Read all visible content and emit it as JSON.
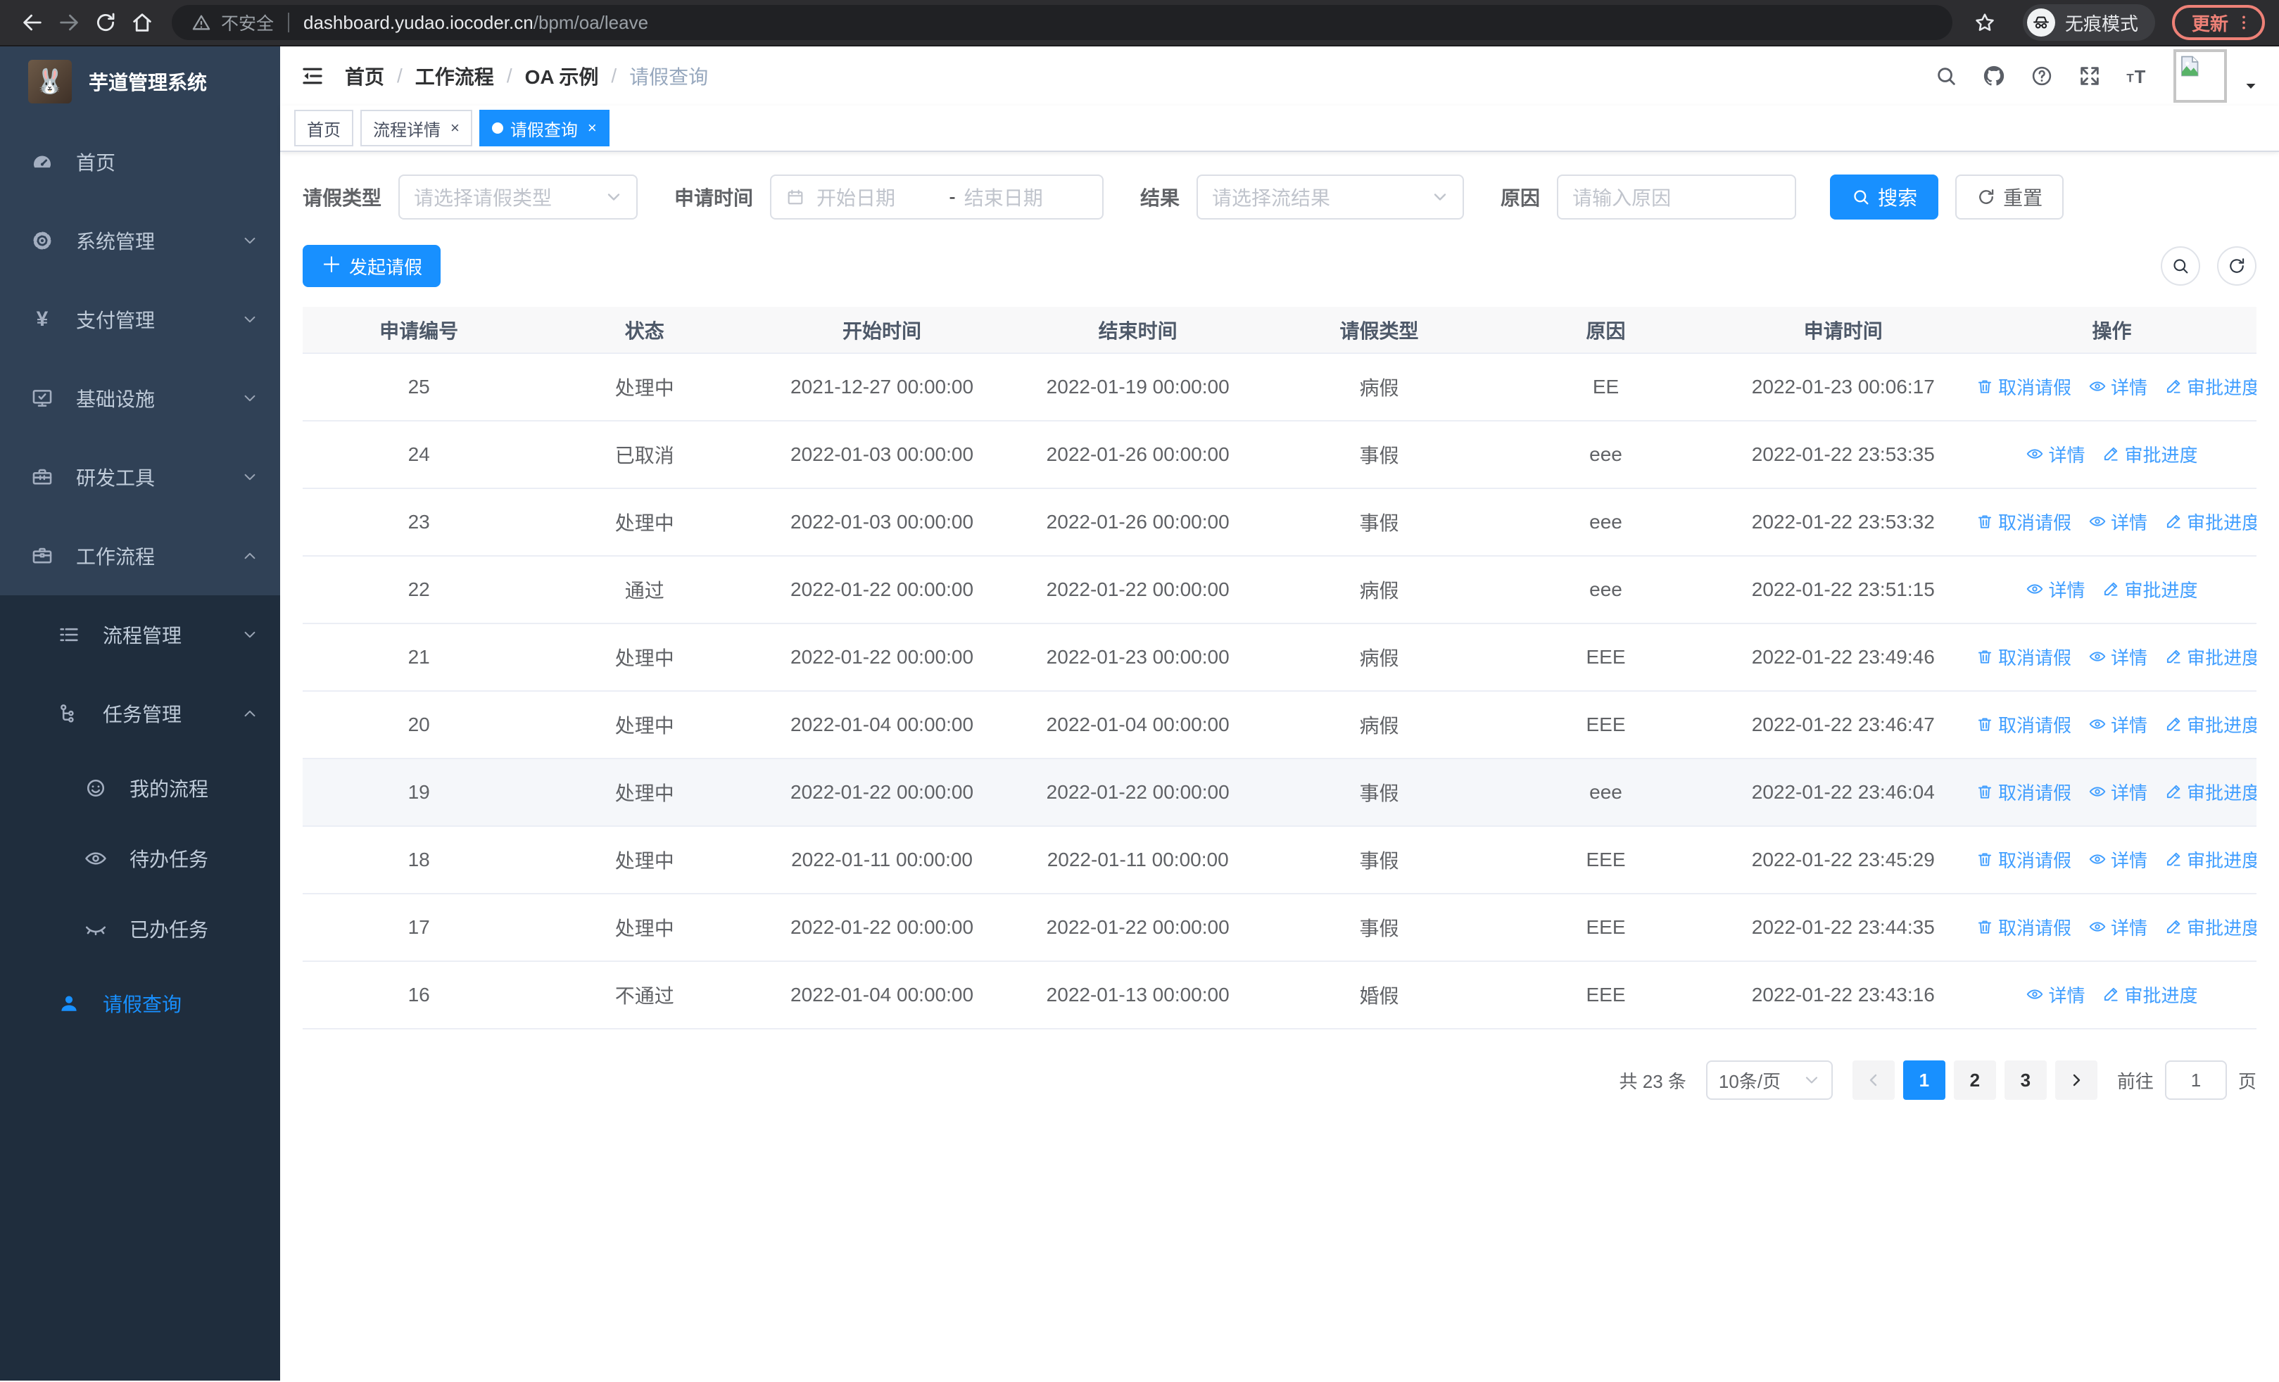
{
  "browser": {
    "security_label": "不安全",
    "url_host": "dashboard.yudao.iocoder.cn",
    "url_path": "/bpm/oa/leave",
    "incognito_label": "无痕模式",
    "update_label": "更新"
  },
  "sidebar": {
    "title": "芋道管理系统",
    "items": [
      {
        "key": "home",
        "label": "首页",
        "icon": "dashboard-icon",
        "level": 1
      },
      {
        "key": "system",
        "label": "系统管理",
        "icon": "gear-icon",
        "level": 1,
        "chevron": "down"
      },
      {
        "key": "payment",
        "label": "支付管理",
        "icon": "yen-icon",
        "level": 1,
        "chevron": "down"
      },
      {
        "key": "infrastructure",
        "label": "基础设施",
        "icon": "monitor-icon",
        "level": 1,
        "chevron": "down"
      },
      {
        "key": "dev-tools",
        "label": "研发工具",
        "icon": "toolbox-icon",
        "level": 1,
        "chevron": "down"
      },
      {
        "key": "workflow",
        "label": "工作流程",
        "icon": "briefcase-icon",
        "level": 1,
        "chevron": "up"
      },
      {
        "key": "process-mgmt",
        "label": "流程管理",
        "icon": "list-icon",
        "level": 2,
        "chevron": "down"
      },
      {
        "key": "task-mgmt",
        "label": "任务管理",
        "icon": "tree-icon",
        "level": 2,
        "chevron": "up"
      },
      {
        "key": "my-process",
        "label": "我的流程",
        "icon": "face-icon",
        "level": 3
      },
      {
        "key": "todo-tasks",
        "label": "待办任务",
        "icon": "eye-open-icon",
        "level": 3
      },
      {
        "key": "done-tasks",
        "label": "已办任务",
        "icon": "eye-closed-icon",
        "level": 3
      },
      {
        "key": "leave-query",
        "label": "请假查询",
        "icon": "user-icon",
        "level": 2,
        "active": true
      }
    ]
  },
  "navbar": {
    "breadcrumb": [
      "首页",
      "工作流程",
      "OA 示例",
      "请假查询"
    ]
  },
  "tabs": [
    {
      "key": "home",
      "label": "首页",
      "closable": false,
      "active": false
    },
    {
      "key": "process-detail",
      "label": "流程详情",
      "closable": true,
      "active": false
    },
    {
      "key": "leave-query",
      "label": "请假查询",
      "closable": true,
      "active": true
    }
  ],
  "search_form": {
    "leave_type": {
      "label": "请假类型",
      "placeholder": "请选择请假类型"
    },
    "apply_time": {
      "label": "申请时间",
      "start_placeholder": "开始日期",
      "separator": "-",
      "end_placeholder": "结束日期"
    },
    "result": {
      "label": "结果",
      "placeholder": "请选择流结果"
    },
    "reason": {
      "label": "原因",
      "placeholder": "请输入原因"
    },
    "search_label": "搜索",
    "reset_label": "重置"
  },
  "toolbar": {
    "create_label": "发起请假"
  },
  "table": {
    "columns": [
      "申请编号",
      "状态",
      "开始时间",
      "结束时间",
      "请假类型",
      "原因",
      "申请时间",
      "操作"
    ],
    "action_labels": {
      "cancel": "取消请假",
      "detail": "详情",
      "progress": "审批进度"
    },
    "rows": [
      {
        "id": "25",
        "status": "处理中",
        "start": "2021-12-27 00:00:00",
        "end": "2022-01-19 00:00:00",
        "type": "病假",
        "reason": "EE",
        "apply": "2022-01-23 00:06:17",
        "actions": [
          "cancel",
          "detail",
          "progress"
        ],
        "highlight": false
      },
      {
        "id": "24",
        "status": "已取消",
        "start": "2022-01-03 00:00:00",
        "end": "2022-01-26 00:00:00",
        "type": "事假",
        "reason": "eee",
        "apply": "2022-01-22 23:53:35",
        "actions": [
          "detail",
          "progress"
        ],
        "highlight": false
      },
      {
        "id": "23",
        "status": "处理中",
        "start": "2022-01-03 00:00:00",
        "end": "2022-01-26 00:00:00",
        "type": "事假",
        "reason": "eee",
        "apply": "2022-01-22 23:53:32",
        "actions": [
          "cancel",
          "detail",
          "progress"
        ],
        "highlight": false
      },
      {
        "id": "22",
        "status": "通过",
        "start": "2022-01-22 00:00:00",
        "end": "2022-01-22 00:00:00",
        "type": "病假",
        "reason": "eee",
        "apply": "2022-01-22 23:51:15",
        "actions": [
          "detail",
          "progress"
        ],
        "highlight": false
      },
      {
        "id": "21",
        "status": "处理中",
        "start": "2022-01-22 00:00:00",
        "end": "2022-01-23 00:00:00",
        "type": "病假",
        "reason": "EEE",
        "apply": "2022-01-22 23:49:46",
        "actions": [
          "cancel",
          "detail",
          "progress"
        ],
        "highlight": false
      },
      {
        "id": "20",
        "status": "处理中",
        "start": "2022-01-04 00:00:00",
        "end": "2022-01-04 00:00:00",
        "type": "病假",
        "reason": "EEE",
        "apply": "2022-01-22 23:46:47",
        "actions": [
          "cancel",
          "detail",
          "progress"
        ],
        "highlight": false
      },
      {
        "id": "19",
        "status": "处理中",
        "start": "2022-01-22 00:00:00",
        "end": "2022-01-22 00:00:00",
        "type": "事假",
        "reason": "eee",
        "apply": "2022-01-22 23:46:04",
        "actions": [
          "cancel",
          "detail",
          "progress"
        ],
        "highlight": true
      },
      {
        "id": "18",
        "status": "处理中",
        "start": "2022-01-11 00:00:00",
        "end": "2022-01-11 00:00:00",
        "type": "事假",
        "reason": "EEE",
        "apply": "2022-01-22 23:45:29",
        "actions": [
          "cancel",
          "detail",
          "progress"
        ],
        "highlight": false
      },
      {
        "id": "17",
        "status": "处理中",
        "start": "2022-01-22 00:00:00",
        "end": "2022-01-22 00:00:00",
        "type": "事假",
        "reason": "EEE",
        "apply": "2022-01-22 23:44:35",
        "actions": [
          "cancel",
          "detail",
          "progress"
        ],
        "highlight": false
      },
      {
        "id": "16",
        "status": "不通过",
        "start": "2022-01-04 00:00:00",
        "end": "2022-01-13 00:00:00",
        "type": "婚假",
        "reason": "EEE",
        "apply": "2022-01-22 23:43:16",
        "actions": [
          "detail",
          "progress"
        ],
        "highlight": false
      }
    ]
  },
  "pagination": {
    "total_label": "共 23 条",
    "page_size_label": "10条/页",
    "pages": [
      "1",
      "2",
      "3"
    ],
    "active_page": "1",
    "goto_label": "前往",
    "goto_value": "1",
    "page_unit": "页"
  },
  "colors": {
    "primary": "#1890ff",
    "link": "#409eff",
    "sidebar_bg": "#304156",
    "submenu_bg": "#1f2d3d"
  }
}
